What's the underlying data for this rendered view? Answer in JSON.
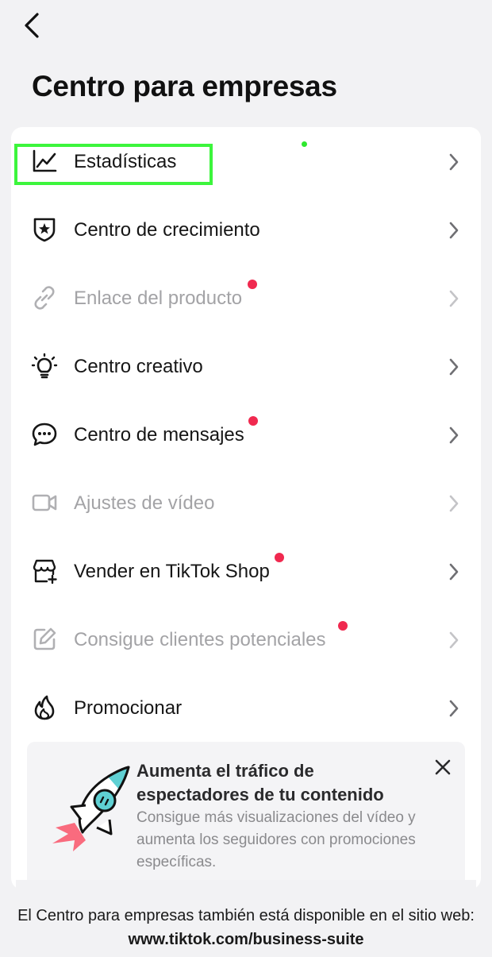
{
  "header": {
    "back_icon": "chevron-left-icon",
    "title": "Centro para empresas"
  },
  "menu": [
    {
      "label": "Estadísticas",
      "icon": "chart-line-icon",
      "enabled": true,
      "badge": false,
      "highlighted": true
    },
    {
      "label": "Centro de crecimiento",
      "icon": "shield-star-icon",
      "enabled": true,
      "badge": false
    },
    {
      "label": "Enlace del producto",
      "icon": "link-icon",
      "enabled": false,
      "badge": true
    },
    {
      "label": "Centro creativo",
      "icon": "lightbulb-icon",
      "enabled": true,
      "badge": false
    },
    {
      "label": "Centro de mensajes",
      "icon": "chat-bubble-icon",
      "enabled": true,
      "badge": true
    },
    {
      "label": "Ajustes de vídeo",
      "icon": "video-camera-icon",
      "enabled": false,
      "badge": false
    },
    {
      "label": "Vender en TikTok Shop",
      "icon": "shop-add-icon",
      "enabled": true,
      "badge": true
    },
    {
      "label": "Consigue clientes potenciales",
      "icon": "edit-form-icon",
      "enabled": false,
      "badge": true
    },
    {
      "label": "Promocionar",
      "icon": "flame-icon",
      "enabled": true,
      "badge": false
    }
  ],
  "promo": {
    "icon": "rocket-icon",
    "title": "Aumenta el tráfico de espectadores de tu contenido",
    "text": "Consigue más visualizaciones del vídeo y aumenta los seguidores con promociones específicas.",
    "close_icon": "close-icon"
  },
  "footer": {
    "text": "El Centro para empresas también está disponible en el sitio web: ",
    "link": "www.tiktok.com/business-suite"
  },
  "colors": {
    "badge": "#f0294f",
    "highlight": "#3cf53c",
    "disabled_text": "#a3a3a6",
    "background": "#f2f2f4"
  }
}
